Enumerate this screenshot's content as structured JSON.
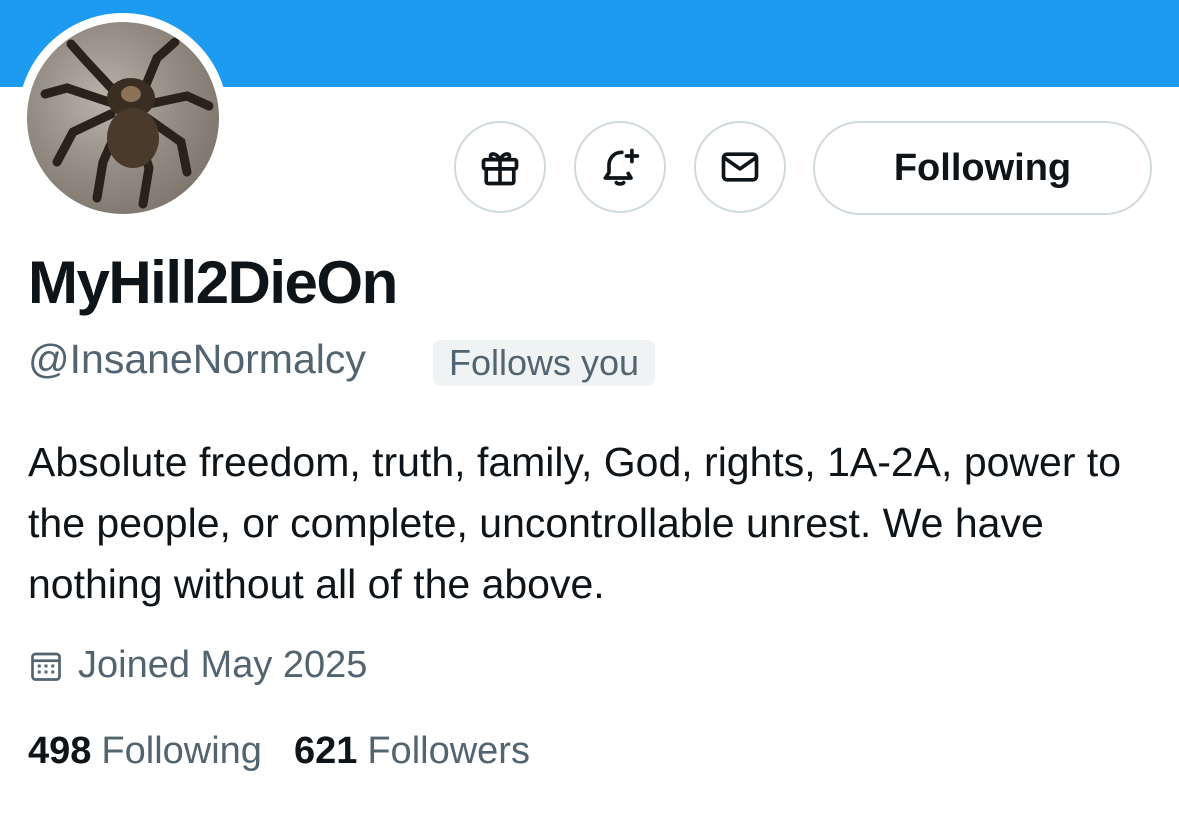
{
  "profile": {
    "display_name": "MyHill2DieOn",
    "handle": "@InsaneNormalcy",
    "follows_you": "Follows you",
    "bio": "Absolute freedom, truth, family, God, rights, 1A-2A, power to the people, or complete, uncontrollable unrest. We have nothing without all of the above.",
    "joined": "Joined May 2025",
    "avatar": "tarantula-photo"
  },
  "actions": {
    "gift_icon": "gift-icon",
    "notify_icon": "bell-plus-icon",
    "message_icon": "envelope-icon",
    "following_label": "Following"
  },
  "stats": {
    "following_count": "498",
    "following_label": "Following",
    "followers_count": "621",
    "followers_label": "Followers"
  },
  "colors": {
    "banner": "#1d9bf0",
    "text_primary": "#0f1419",
    "text_secondary": "#536471",
    "border": "#cfd9de"
  }
}
